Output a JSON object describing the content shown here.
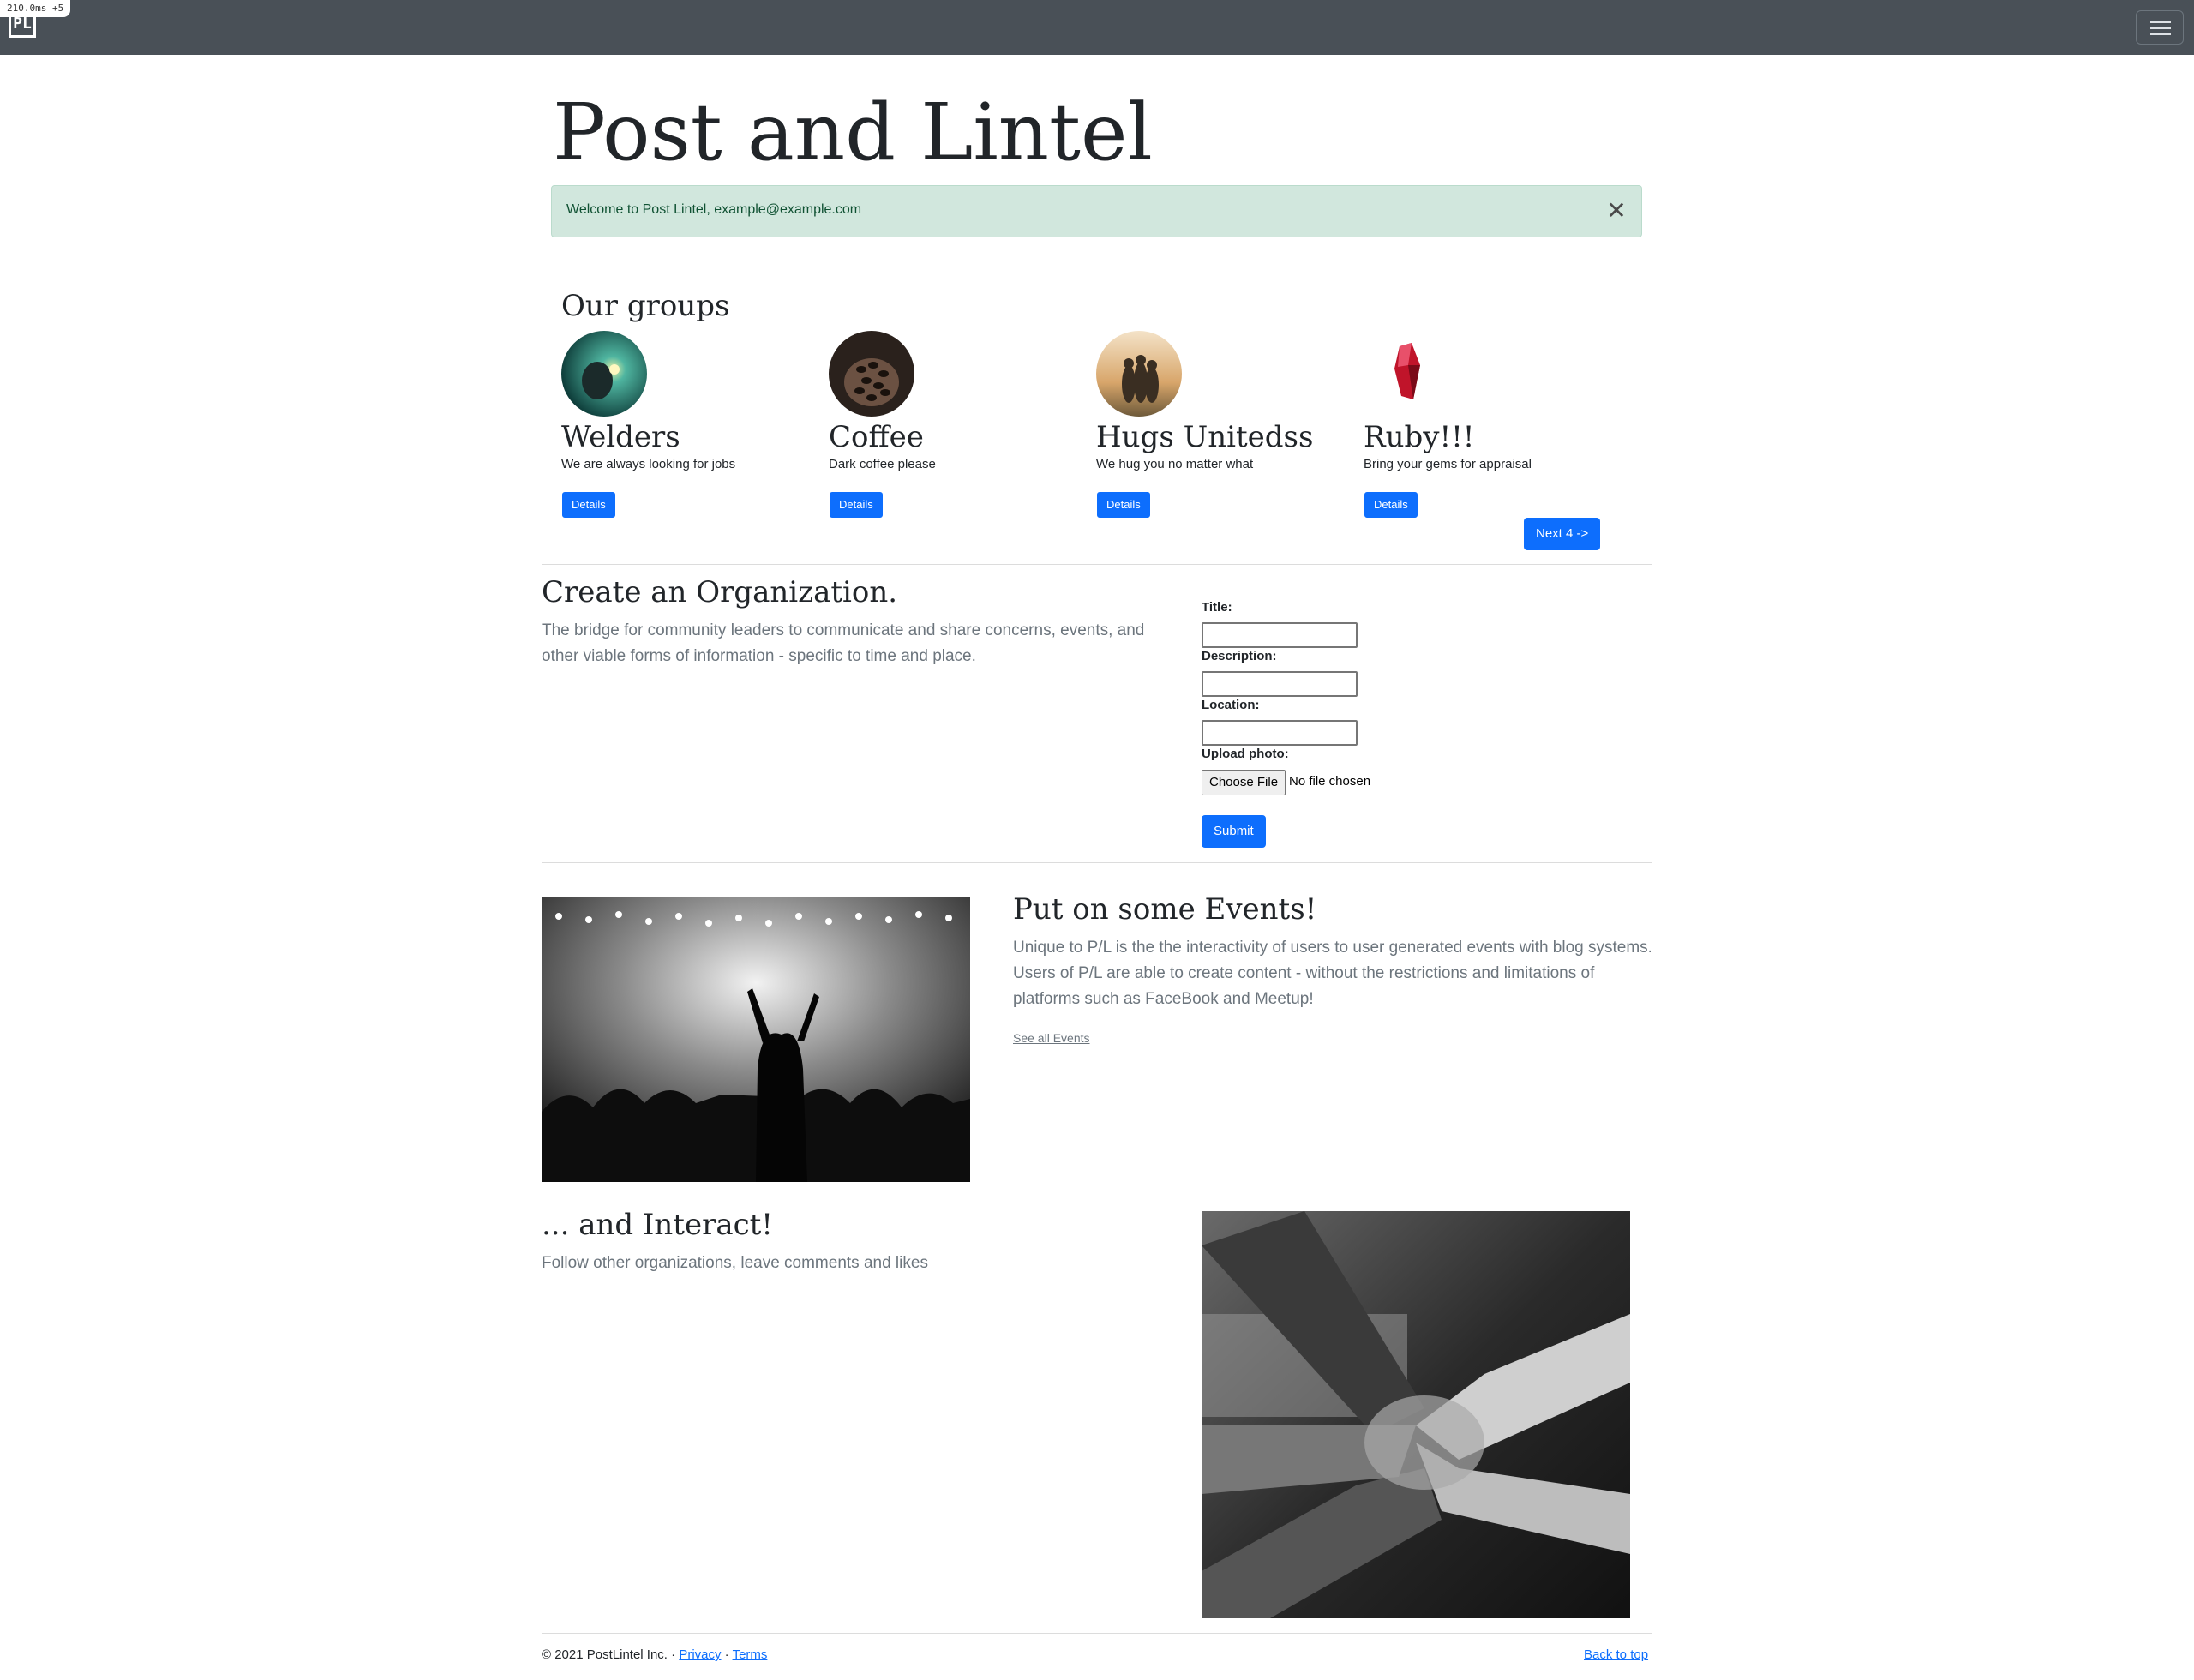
{
  "debug": {
    "badge": "210.0ms +5"
  },
  "navbar": {
    "logo_text": "PL",
    "toggler_icon": "hamburger-icon"
  },
  "hero": {
    "title": "Post and Lintel"
  },
  "alert": {
    "message": "Welcome to Post Lintel, example@example.com",
    "close_icon": "close-icon",
    "color": "#d1e7dd"
  },
  "groups": {
    "heading": "Our groups",
    "items": [
      {
        "name": "Welders",
        "description": "We are always looking for jobs",
        "button": "Details"
      },
      {
        "name": "Coffee",
        "description": "Dark coffee please",
        "button": "Details"
      },
      {
        "name": "Hugs Unitedss",
        "description": "We hug you no matter what",
        "button": "Details"
      },
      {
        "name": "Ruby!!!",
        "description": "Bring your gems for appraisal",
        "button": "Details"
      }
    ],
    "next_button": "Next 4 ->"
  },
  "organization": {
    "heading": "Create an Organization.",
    "lead": "The bridge for community leaders to communicate and share concerns, events, and other viable forms of information - specific to time and place.",
    "form": {
      "title_label": "Title:",
      "description_label": "Description:",
      "location_label": "Location:",
      "photo_label": "Upload photo:",
      "file_button": "Choose File",
      "file_status": "No file chosen",
      "submit": "Submit"
    }
  },
  "events": {
    "heading": "Put on some Events!",
    "lead": "Unique to P/L is the the interactivity of users to user generated events with blog systems. Users of P/L are able to create content - without the restrictions and limitations of platforms such as FaceBook and Meetup!",
    "link": "See all Events"
  },
  "interact": {
    "heading": "... and Interact!",
    "lead": "Follow other organizations, leave comments and likes"
  },
  "footer": {
    "copyright": "© 2021 PostLintel Inc. · ",
    "privacy": "Privacy",
    "separator": " · ",
    "terms": "Terms",
    "back_to_top": "Back to top"
  },
  "colors": {
    "navbar": "#495057",
    "primary": "#0d6efd",
    "alert_bg": "#d1e7dd",
    "alert_text": "#0f5132"
  }
}
